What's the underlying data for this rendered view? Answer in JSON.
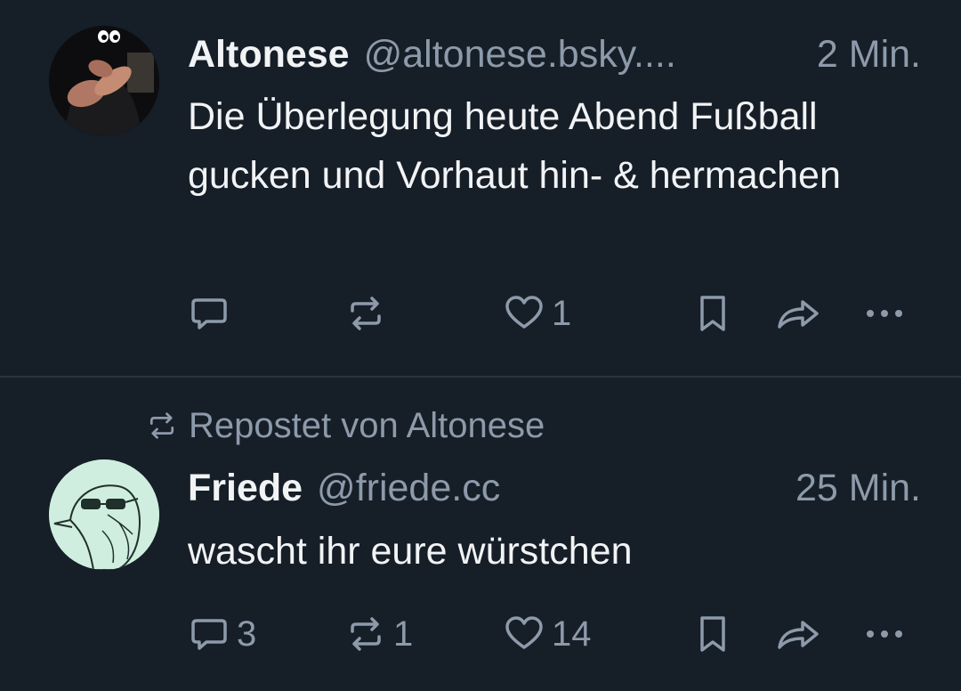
{
  "colors": {
    "background": "#161e27",
    "divider": "#2a3541",
    "text_primary": "#f1f3f5",
    "text_secondary": "#8c9aaa"
  },
  "feed": {
    "posts": [
      {
        "author": {
          "display_name": "Altonese",
          "handle": "@altonese.bsky....",
          "avatar_icon": "user-avatar"
        },
        "time": "2 Min.",
        "text": "Die Überlegung heute Abend Fußball gucken und Vorhaut hin- & hermachen",
        "actions": {
          "reply_count": "",
          "repost_count": "",
          "like_count": "1"
        }
      },
      {
        "repost_label": "Repostet von Altonese",
        "author": {
          "display_name": "Friede",
          "handle": "@friede.cc",
          "avatar_icon": "user-avatar"
        },
        "time": "25 Min.",
        "text": "wascht ihr eure würstchen",
        "actions": {
          "reply_count": "3",
          "repost_count": "1",
          "like_count": "14"
        }
      }
    ]
  }
}
